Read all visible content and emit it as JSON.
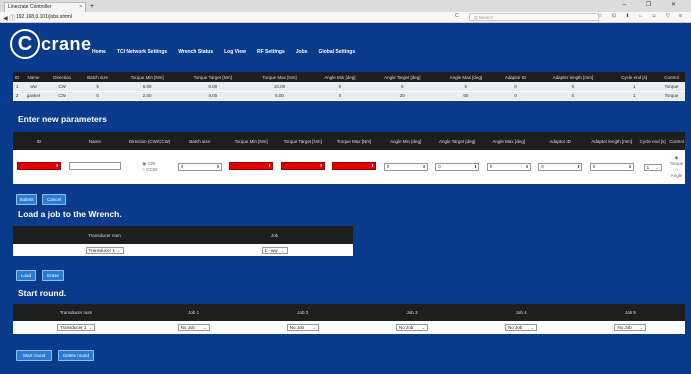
{
  "browser": {
    "tab_title": "Linecrate Controller",
    "tab_close": "×",
    "new_tab": "+",
    "window_controls": "– ❐ ✕",
    "nav": "◀ ⓘ",
    "url": "192.168.0.101/jobs.shtml",
    "reload": "C",
    "search_placeholder": "Q Search",
    "toolbar_icons": "☆ ⊡ ⬇ ⌂ ☺ ▽ ≡"
  },
  "header": {
    "logo_letter": "C",
    "logo_text": "crane",
    "menu": [
      "Home",
      "TCI Network Settings",
      "Wrench Status",
      "Log View",
      "RF Settings",
      "Jobs",
      "Global Settings"
    ]
  },
  "jobs_table": {
    "columns": [
      "ID",
      "Name",
      "Direction",
      "Batch size",
      "Torque Min [Nm]",
      "Torque Target [Nm]",
      "Torque Max [Nm]",
      "Angle Min [deg]",
      "Angle Target [deg]",
      "Angle Max [deg]",
      "Adaptor ID",
      "Adapter length [mm]",
      "Cycle end [s]",
      "Control"
    ],
    "rows": [
      [
        "1",
        "ww",
        "CW",
        "5",
        "6.00",
        "8.00",
        "10.00",
        "0",
        "0",
        "0",
        "0",
        "0",
        "1",
        "Torque"
      ],
      [
        "2",
        "gasket",
        "CW",
        "0",
        "2.00",
        "4.00",
        "5.00",
        "0",
        "20",
        "60",
        "0",
        "0",
        "1",
        "Torque"
      ]
    ]
  },
  "new_params": {
    "title": "Enter new parameters",
    "columns": [
      "ID",
      "Name",
      "Direction (CW/CCW)",
      "Batch size",
      "Torque Min [Nm]",
      "Torque Target [Nm]",
      "Torque Max [Nm]",
      "Angle Min [deg]",
      "Angle Target [deg]",
      "Angle Max [deg]",
      "Adaptor ID",
      "Adapter length [mm]",
      "Cycle end [s]",
      "Control"
    ],
    "id_value": "",
    "name_value": "",
    "direction_options": [
      "CW",
      "CCW"
    ],
    "batch_value": "0",
    "torque_min": "",
    "torque_target": "",
    "torque_max": "",
    "angle_min": "0",
    "angle_target": "0",
    "angle_max": "0",
    "adaptor_id": "0",
    "adapter_length": "0",
    "cycle_end": "1",
    "control_options": [
      "Torque",
      "Angle"
    ],
    "spin": "⬍",
    "submit_label": "Submit",
    "cancel_label": "Cancel"
  },
  "load_job": {
    "title": "Load a job to the Wrench.",
    "columns": [
      "Transducer num",
      "Job"
    ],
    "transducer_value": "Transducer 1",
    "job_value": "1 - ww",
    "load_label": "Load",
    "erase_label": "Erase"
  },
  "round": {
    "title": "Start round.",
    "columns": [
      "Transducer num",
      "Job 1",
      "Job 2",
      "Job 3",
      "Job 4",
      "Job 5"
    ],
    "transducer_value": "Transducer 1",
    "job_values": [
      "No Job",
      "No Job",
      "No Job",
      "No Job",
      "No Job"
    ],
    "start_label": "Start round",
    "delete_label": "Delete round"
  },
  "icons": {
    "chevron": "⌄"
  }
}
